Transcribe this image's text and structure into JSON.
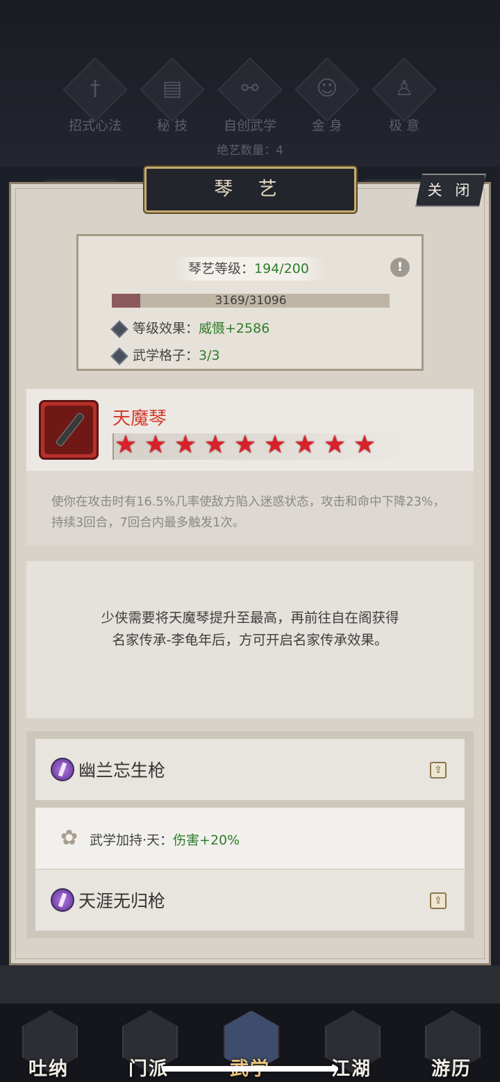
{
  "top_tabs": [
    {
      "label": "招式心法",
      "icon": "sword-icon"
    },
    {
      "label": "秘 技",
      "icon": "book-icon"
    },
    {
      "label": "自创武学",
      "icon": "scroll-icon"
    },
    {
      "label": "金 身",
      "icon": "meditation-icon"
    },
    {
      "label": "极 意",
      "icon": "stance-icon"
    }
  ],
  "skill_count": "绝艺数量：4",
  "panel": {
    "title": "琴 艺",
    "close_label": "关 闭"
  },
  "level": {
    "label": "琴艺等级：",
    "value": "194/200",
    "progress_text": "3169/31096",
    "progress_fraction": 0.102,
    "effect_label": "等级效果：",
    "effect_value": "威慑+2586",
    "slots_label": "武学格子：",
    "slots_value": "3/3",
    "info_glyph": "!"
  },
  "item": {
    "name": "天魔琴",
    "stars": 9,
    "star_glyph": "★",
    "description": "使你在攻击时有16.5%几率使敌方陷入迷惑状态，攻击和命中下降23%，持续3回合，7回合内最多触发1次。"
  },
  "notice": "少侠需要将天魔琴提升至最高，再前往自在阁获得名家传承-李龟年后，方可开启名家传承效果。",
  "skills": [
    {
      "name": "幽兰忘生枪"
    },
    {
      "name": "天涯无归枪"
    }
  ],
  "bonus": {
    "label": "武学加持·天：",
    "value": "伤害+20%",
    "glyph": "✿"
  },
  "bottom_nav": [
    {
      "label": "吐纳"
    },
    {
      "label": "门派"
    },
    {
      "label": "武学"
    },
    {
      "label": "江湖"
    },
    {
      "label": "游历"
    }
  ],
  "colors": {
    "green_value": "#2f7d2a",
    "item_name_red": "#d43b2c",
    "star_red": "#d8212a",
    "panel_bg": "#d8d2c8"
  }
}
